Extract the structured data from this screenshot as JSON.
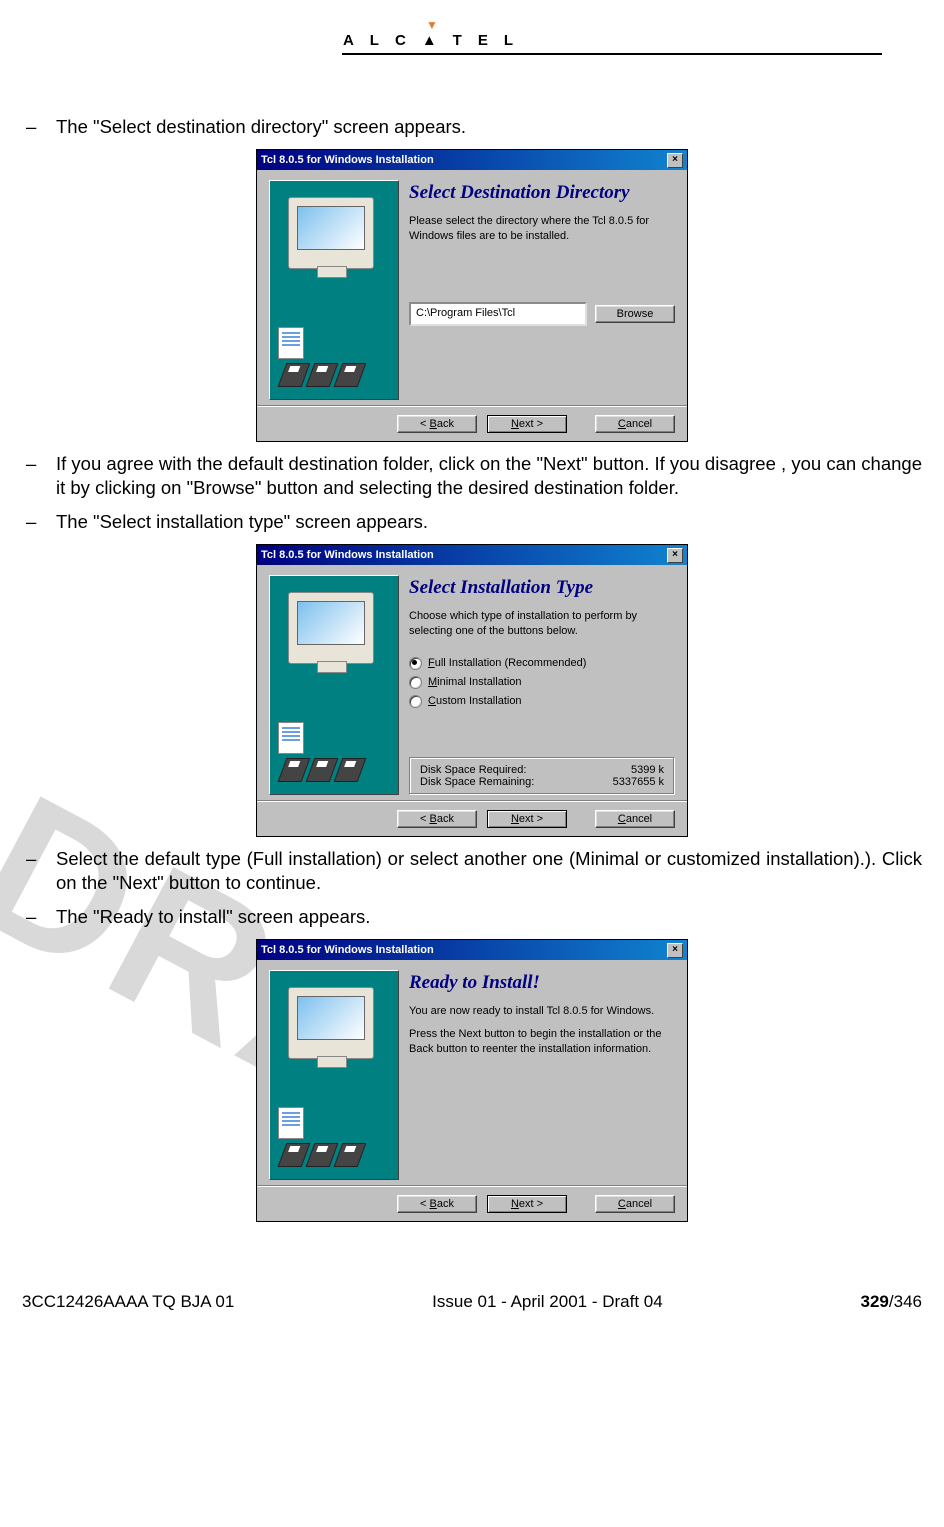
{
  "brand": "ALCATEL",
  "watermark": "DRAFT",
  "bullets": {
    "b1": "The \"Select destination directory\" screen appears.",
    "b2": "If you agree with the default destination folder, click on the \"Next\" button. If you disagree , you can change it by clicking on \"Browse\" button and selecting the desired destination folder.",
    "b3": "The \"Select installation type\" screen appears.",
    "b4": "Select the default type (Full installation) or select another one (Minimal or customized installation).). Click on the \"Next\" button to continue.",
    "b5": "The \"Ready to install\" screen appears."
  },
  "dialog_title": "Tcl 8.0.5 for Windows Installation",
  "close_glyph": "×",
  "btn_back": "< Back",
  "btn_next": "Next >",
  "btn_cancel": "Cancel",
  "btn_browse": "Browse",
  "d1": {
    "heading": "Select Destination Directory",
    "text": "Please select the directory where the Tcl 8.0.5 for Windows files are to be installed.",
    "path": "C:\\Program Files\\Tcl"
  },
  "d2": {
    "heading": "Select Installation Type",
    "text": "Choose which type of installation to perform by selecting one of the buttons below.",
    "opt1": "Full Installation (Recommended)",
    "opt2": "Minimal Installation",
    "opt3": "Custom Installation",
    "req_label": "Disk Space Required:",
    "req_val": "5399 k",
    "rem_label": "Disk Space Remaining:",
    "rem_val": "5337655 k"
  },
  "d3": {
    "heading": "Ready to Install!",
    "text1": "You are now ready to install Tcl 8.0.5 for Windows.",
    "text2": "Press the Next button to begin the installation or the Back button to reenter the installation information."
  },
  "footer": {
    "left": "3CC12426AAAA TQ BJA 01",
    "center": "Issue 01 - April 2001 - Draft 04",
    "page_bold": "329",
    "page_total": "/346"
  }
}
